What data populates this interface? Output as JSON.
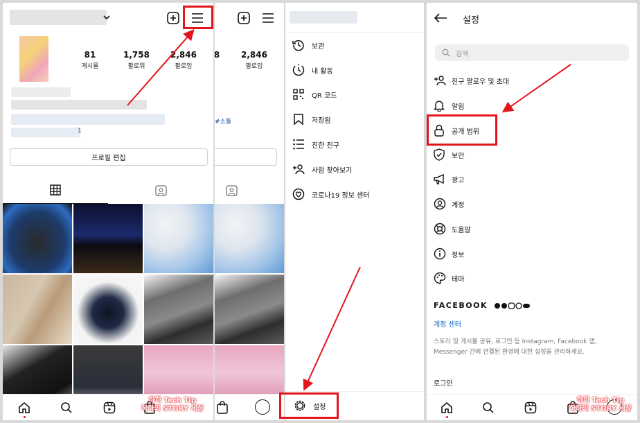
{
  "profile": {
    "stats": [
      {
        "value": "81",
        "label": "게시물"
      },
      {
        "value": "1,758",
        "label": "팔로워"
      },
      {
        "value": "2,846",
        "label": "팔로잉"
      }
    ],
    "edit_button": "프로필 편집",
    "partial_stats": [
      {
        "value": "8"
      },
      {
        "value": "2,846",
        "label": "팔로잉"
      }
    ],
    "partial_tag": "#소통",
    "partial_count": "1"
  },
  "menu": {
    "items": [
      {
        "label": "보관",
        "icon": "archive-icon"
      },
      {
        "label": "내 활동",
        "icon": "activity-icon"
      },
      {
        "label": "QR 코드",
        "icon": "qr-code-icon"
      },
      {
        "label": "저장됨",
        "icon": "bookmark-icon"
      },
      {
        "label": "친한 친구",
        "icon": "close-friends-icon"
      },
      {
        "label": "사람 찾아보기",
        "icon": "discover-people-icon"
      },
      {
        "label": "코로나19 정보 센터",
        "icon": "covid-info-icon"
      }
    ],
    "settings_label": "설정"
  },
  "settings": {
    "title": "설정",
    "search_placeholder": "검색",
    "items": [
      {
        "label": "친구 팔로우 및 초대",
        "icon": "add-person-icon"
      },
      {
        "label": "알림",
        "icon": "bell-icon"
      },
      {
        "label": "공개 범위",
        "icon": "lock-icon"
      },
      {
        "label": "보안",
        "icon": "shield-icon"
      },
      {
        "label": "광고",
        "icon": "megaphone-icon"
      },
      {
        "label": "계정",
        "icon": "account-icon"
      },
      {
        "label": "도움말",
        "icon": "help-icon"
      },
      {
        "label": "정보",
        "icon": "info-icon"
      },
      {
        "label": "테마",
        "icon": "palette-icon"
      }
    ],
    "facebook_heading": "FACEBOOK",
    "accounts_center": "계정 센터",
    "facebook_description": "스토리 및 게시물 공유, 로그인 등 Instagram, Facebook 앱, Messenger 간에 연결된 환경에 대한 설정을 관리하세요.",
    "login_label": "로그인"
  },
  "watermark": {
    "line1": "하하 Tech Tip",
    "line2": "하하의 STORY 세상"
  },
  "colors": {
    "highlight": "#e3151c",
    "link": "#0a66c2"
  }
}
